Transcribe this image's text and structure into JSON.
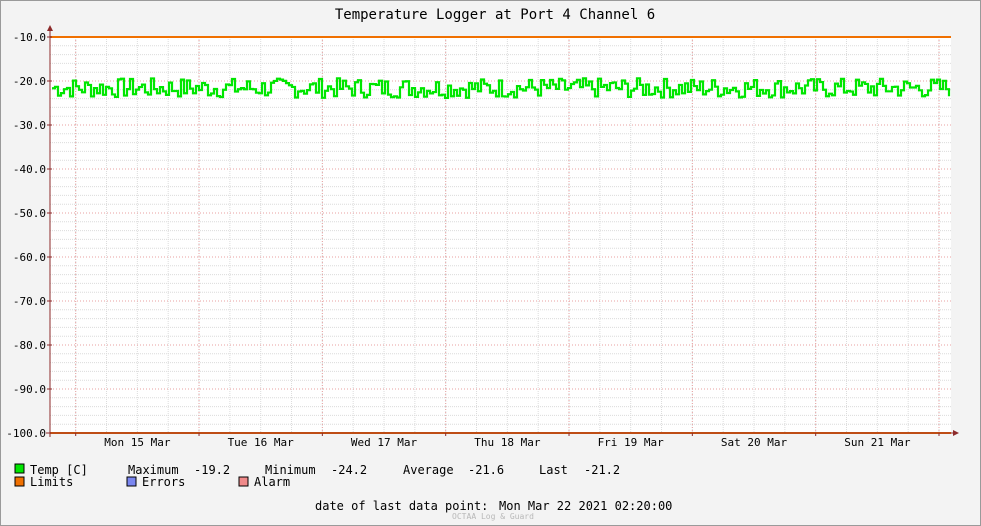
{
  "chart_data": {
    "type": "line",
    "title": "Temperature Logger at Port 4 Channel 6",
    "ylim": [
      -100,
      -10
    ],
    "yticks": [
      -10,
      -20,
      -30,
      -40,
      -50,
      -60,
      -70,
      -80,
      -90,
      -100
    ],
    "ytick_labels": [
      "-10.0",
      "-20.0",
      "-30.0",
      "-40.0",
      "-50.0",
      "-60.0",
      "-70.0",
      "-80.0",
      "-90.0",
      "-100.0"
    ],
    "x_day_labels": [
      "Mon 15 Mar",
      "Tue 16 Mar",
      "Wed 17 Mar",
      "Thu 18 Mar",
      "Fri 19 Mar",
      "Sat 20 Mar",
      "Sun 21 Mar"
    ],
    "x_range": [
      "2021-03-14 19:00",
      "2021-03-22 02:20"
    ],
    "grid": true,
    "series": [
      {
        "name": "Temp [C]",
        "color": "#00e600",
        "band": [
          -19.2,
          -24.2
        ],
        "average": -21.6,
        "last": -21.2
      },
      {
        "name": "Limits",
        "color": "#f07000",
        "values": [
          -10,
          -100
        ]
      }
    ]
  },
  "legend": {
    "temp_label": "Temp [C]",
    "maximum_label": "Maximum",
    "maximum_value": "-19.2",
    "minimum_label": "Minimum",
    "minimum_value": "-24.2",
    "average_label": "Average",
    "average_value": "-21.6",
    "last_label": "Last",
    "last_value": "-21.2",
    "limits_label": "Limits",
    "errors_label": "Errors",
    "alarm_label": "Alarm",
    "colors": {
      "temp": "#00e600",
      "limits": "#f07000",
      "errors": "#7a86f0",
      "alarm": "#f08a8a"
    }
  },
  "footer": {
    "last_point_label": "date of last data point:",
    "last_point_value": "Mon Mar 22 2021 02:20:00",
    "watermark": "OCTAA Log & Guard"
  }
}
